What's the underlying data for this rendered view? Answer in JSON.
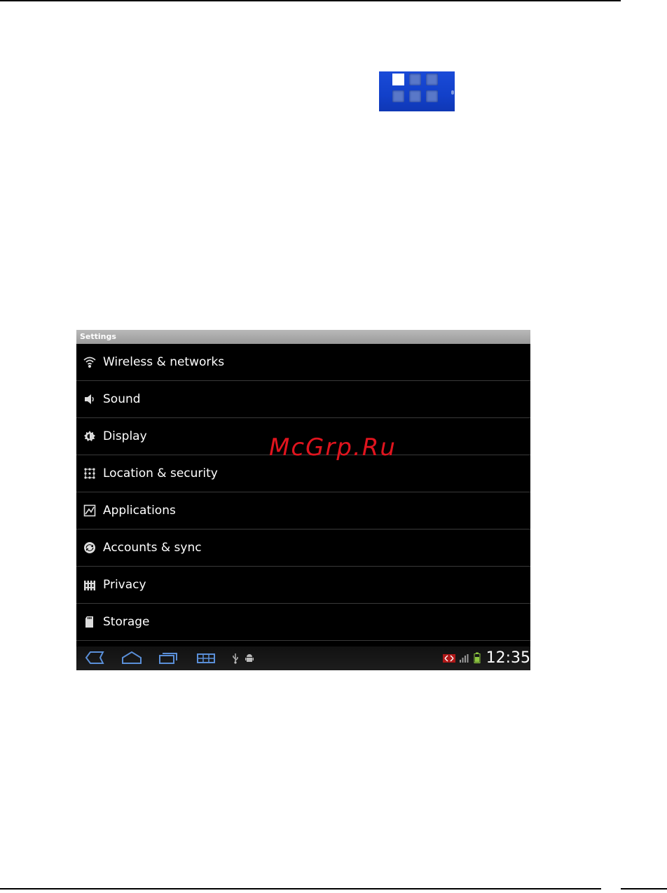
{
  "settings": {
    "title": "Settings",
    "items": [
      {
        "label": "Wireless & networks",
        "icon": "wifi-icon"
      },
      {
        "label": "Sound",
        "icon": "speaker-icon"
      },
      {
        "label": "Display",
        "icon": "brightness-icon"
      },
      {
        "label": "Location & security",
        "icon": "pattern-lock-icon"
      },
      {
        "label": "Applications",
        "icon": "applications-icon"
      },
      {
        "label": "Accounts & sync",
        "icon": "sync-icon"
      },
      {
        "label": "Privacy",
        "icon": "privacy-icon"
      },
      {
        "label": "Storage",
        "icon": "sd-card-icon"
      }
    ]
  },
  "watermark": "McGrp.Ru",
  "statusbar": {
    "clock": "12:35"
  },
  "colors": {
    "apps_icon_blue": "#1240c9",
    "watermark_red": "#e0141e",
    "battery_green": "#8cc63f"
  }
}
